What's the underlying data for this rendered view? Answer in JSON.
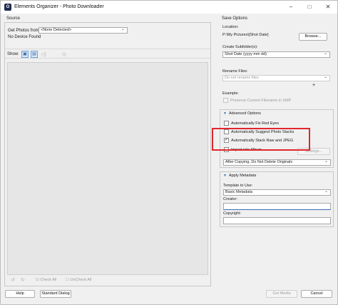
{
  "window": {
    "title": "Elements Organizer - Photo Downloader",
    "app_icon_glyph": "O",
    "minimize_glyph": "–",
    "maximize_glyph": "□",
    "close_glyph": "✕"
  },
  "source": {
    "header": "Source",
    "get_photos_label": "Get Photos from:",
    "get_photos_value": "<None Detected>",
    "status": "No Device Found",
    "show_label": "Show:",
    "check_all": "Check All",
    "uncheck_all": "UnCheck All"
  },
  "save_options": {
    "header": "Save Options",
    "location_label": "Location:",
    "location_value": "P:\\My Pictures\\[Shot Date]",
    "browse_label": "Browse...",
    "subfolder_label": "Create Subfolder(s):",
    "subfolder_value": "Shot Date (yyyy mm dd)",
    "rename_label": "Rename Files:",
    "rename_value": "Do not rename files",
    "plus_glyph": "+",
    "example_label": "Example:",
    "preserve_label": "Preserve Current Filename in XMP"
  },
  "advanced": {
    "header": "Advanced Options",
    "fix_red_eyes": "Automatically Fix Red Eyes",
    "suggest_stacks": "Automatically Suggest Photo Stacks",
    "stack_raw": "Automatically Stack Raw and JPEG",
    "stack_raw_checked": "✓",
    "import_album": "Import into Album",
    "settings_label": "Settings...",
    "after_copying": "After Copying, Do Not Delete Originals"
  },
  "metadata": {
    "header": "Apply Metadata",
    "template_label": "Template to Use:",
    "template_value": "Basic Metadata",
    "creator_label": "Creator:",
    "creator_value": "",
    "copyright_label": "Copyright:",
    "copyright_value": ""
  },
  "footer": {
    "help": "Help",
    "standard_dialog": "Standard Dialog",
    "get_media": "Get Media",
    "cancel": "Cancel"
  },
  "colors": {
    "highlight_box": "#e0262c",
    "accent": "#3a6db3"
  }
}
